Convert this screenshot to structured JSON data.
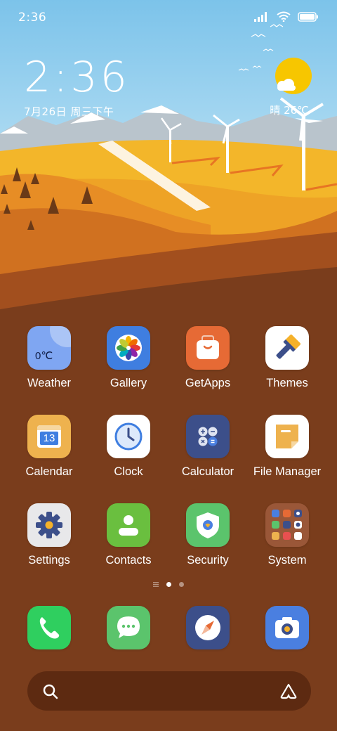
{
  "status_bar": {
    "time": "2:36"
  },
  "clock_widget": {
    "time": "2:36",
    "date": "7月26日 周三下午"
  },
  "weather": {
    "text": "晴 26℃"
  },
  "apps": [
    {
      "label": "Weather",
      "icon_text": "0℃",
      "icon": "weather-icon"
    },
    {
      "label": "Gallery",
      "icon": "gallery-icon"
    },
    {
      "label": "GetApps",
      "icon": "getapps-icon"
    },
    {
      "label": "Themes",
      "icon": "themes-icon"
    },
    {
      "label": "Calendar",
      "icon_text": "13",
      "icon": "calendar-icon"
    },
    {
      "label": "Clock",
      "icon": "clock-icon"
    },
    {
      "label": "Calculator",
      "icon": "calculator-icon"
    },
    {
      "label": "File Manager",
      "icon": "file-manager-icon"
    },
    {
      "label": "Settings",
      "icon": "settings-icon"
    },
    {
      "label": "Contacts",
      "icon": "contacts-icon"
    },
    {
      "label": "Security",
      "icon": "security-icon"
    },
    {
      "label": "System",
      "icon": "folder-icon"
    }
  ],
  "dock": [
    {
      "icon": "phone-icon"
    },
    {
      "icon": "messages-icon"
    },
    {
      "icon": "browser-icon"
    },
    {
      "icon": "camera-icon"
    }
  ],
  "colors": {
    "accent_blue": "#4a7fe0",
    "sun": "#f7c600",
    "ground": "#7a3d1c"
  }
}
